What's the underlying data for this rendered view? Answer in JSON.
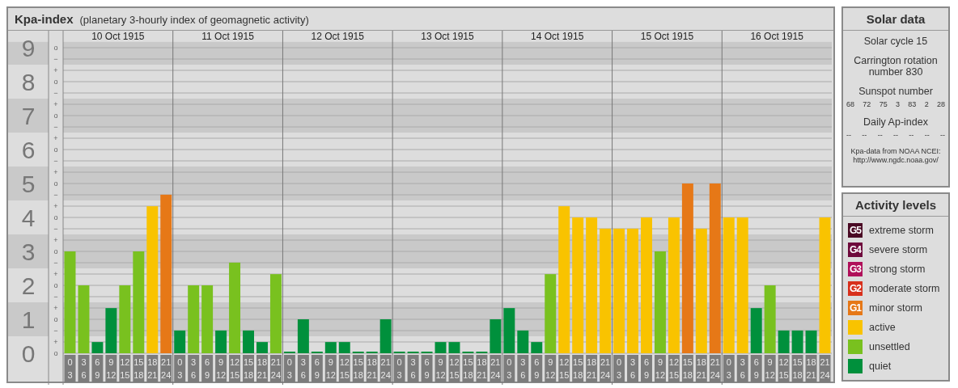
{
  "chart_panel": {
    "title": "Kpa-index",
    "subtitle": "(planetary 3-hourly index of geomagnetic activity)",
    "days": [
      "10 Oct 1915",
      "11 Oct 1915",
      "12 Oct 1915",
      "13 Oct 1915",
      "14 Oct 1915",
      "15 Oct 1915",
      "16 Oct 1915"
    ],
    "minor_tick_labels": [
      "o",
      "−",
      "+",
      "o",
      "−",
      "+",
      "o",
      "−",
      "+",
      "o",
      "−",
      "+",
      "o",
      "−",
      "+",
      "o",
      "−",
      "+",
      "o",
      "−",
      "+",
      "o",
      "−",
      "+",
      "o",
      "−",
      "+",
      "o"
    ],
    "chart_data": {
      "type": "bar",
      "ylim": [
        0,
        9
      ],
      "grid": true,
      "yticks": [
        {
          "value": 9,
          "label": "9"
        },
        {
          "value": 8,
          "label": "8"
        },
        {
          "value": 7,
          "label": "7"
        },
        {
          "value": 6,
          "label": "6"
        },
        {
          "value": 5,
          "label": "5"
        },
        {
          "value": 4,
          "label": "4"
        },
        {
          "value": 3,
          "label": "3"
        },
        {
          "value": 2,
          "label": "2"
        },
        {
          "value": 1,
          "label": "1"
        },
        {
          "value": 0,
          "label": "0"
        }
      ],
      "categories": [
        "0\n3",
        "3\n6",
        "6\n9",
        "9\n12",
        "12\n15",
        "15\n18",
        "18\n21",
        "21\n24",
        "0\n3",
        "3\n6",
        "6\n9",
        "9\n12",
        "12\n15",
        "15\n18",
        "18\n21",
        "21\n24",
        "0\n3",
        "3\n6",
        "6\n9",
        "9\n12",
        "12\n15",
        "15\n18",
        "18\n21",
        "21\n24",
        "0\n3",
        "3\n6",
        "6\n9",
        "9\n12",
        "12\n15",
        "15\n18",
        "18\n21",
        "21\n24",
        "0\n3",
        "3\n6",
        "6\n9",
        "9\n12",
        "12\n15",
        "15\n18",
        "18\n21",
        "21\n24",
        "0\n3",
        "3\n6",
        "6\n9",
        "9\n12",
        "12\n15",
        "15\n18",
        "18\n21",
        "21\n24",
        "0\n3",
        "3\n6",
        "6\n9",
        "9\n12",
        "12\n15",
        "15\n18",
        "18\n21",
        "21\n24"
      ],
      "values": [
        3,
        2,
        0.33,
        1.33,
        2,
        3,
        4.33,
        4.67,
        0.67,
        2,
        2,
        0.67,
        2.67,
        0.67,
        0.33,
        2.33,
        0,
        1,
        0,
        0.33,
        0.33,
        0,
        0,
        1,
        0,
        0,
        0,
        0.33,
        0.33,
        0,
        0,
        1,
        1.33,
        0.67,
        0.33,
        2.33,
        4.33,
        4,
        4,
        3.67,
        3.67,
        3.67,
        4,
        3,
        4,
        5,
        3.67,
        5,
        4,
        4,
        1.33,
        2,
        0.67,
        0.67,
        0.67,
        4
      ]
    }
  },
  "solar_data": {
    "title": "Solar data",
    "solar_cycle": "Solar cycle 15",
    "carrington": "Carrington rotation number 830",
    "sunspot_title": "Sunspot number",
    "sunspots": [
      "68",
      "72",
      "75",
      "3",
      "83",
      "2",
      "28"
    ],
    "ap_title": "Daily Ap-index",
    "ap_values": [
      "--",
      "--",
      "--",
      "--",
      "--",
      "--",
      "--"
    ],
    "source": "Kpa-data from NOAA NCEI:",
    "source_url": "http://www.ngdc.noaa.gov/"
  },
  "activity_levels": {
    "title": "Activity levels",
    "items": [
      {
        "badge": "G5",
        "label": "extreme storm",
        "color": "#4a0a24"
      },
      {
        "badge": "G4",
        "label": "severe storm",
        "color": "#6e0a3c"
      },
      {
        "badge": "G3",
        "label": "strong storm",
        "color": "#b0105a"
      },
      {
        "badge": "G2",
        "label": "moderate storm",
        "color": "#d8301c"
      },
      {
        "badge": "G1",
        "label": "minor storm",
        "color": "#e67817"
      },
      {
        "label": "active",
        "color": "#f9c300"
      },
      {
        "label": "unsettled",
        "color": "#79c11f"
      },
      {
        "label": "quiet",
        "color": "#00903c"
      }
    ]
  }
}
